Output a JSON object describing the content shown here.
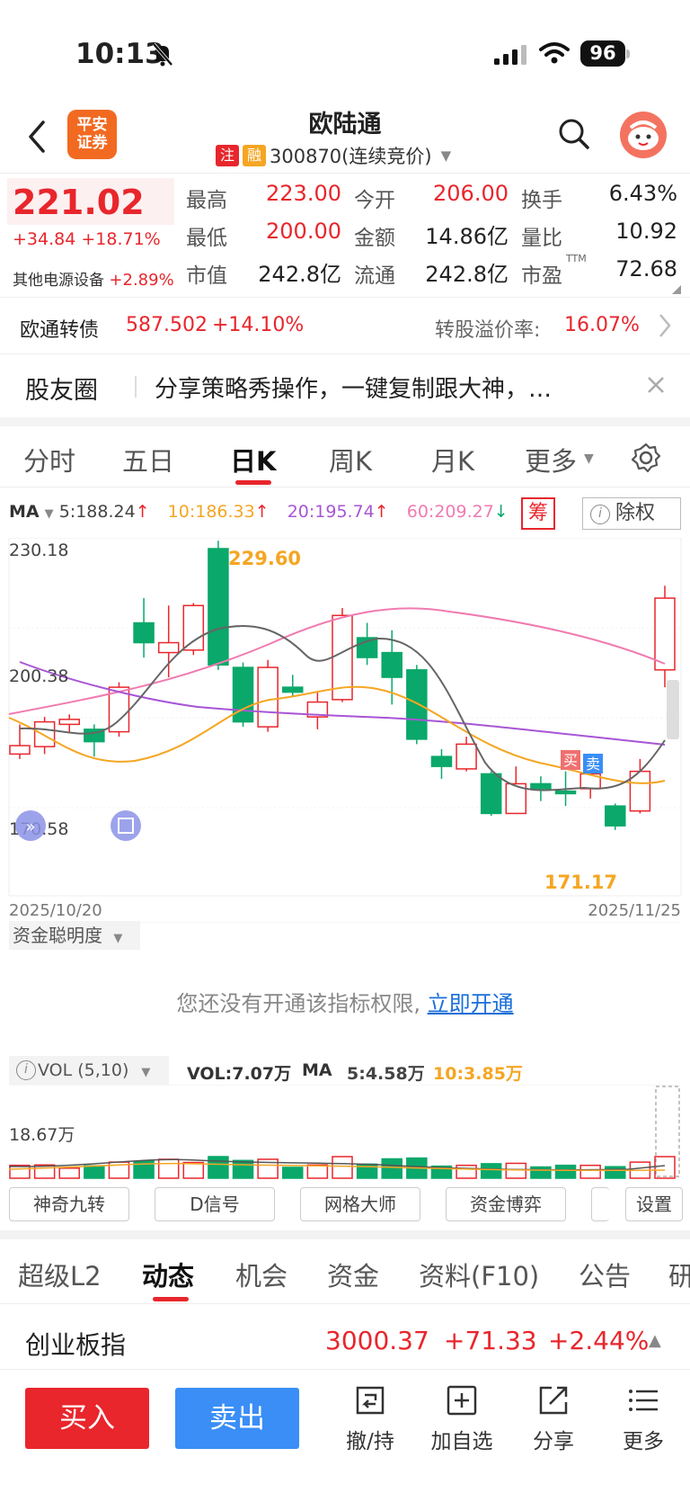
{
  "status_bar": {
    "time": "10:13",
    "battery": "96"
  },
  "header": {
    "logo_text_1": "平安",
    "logo_text_2": "证券",
    "stock_name": "欧陆通",
    "tag_1": "注",
    "tag_2": "融",
    "code_status": "300870(连续竞价)",
    "colors": {
      "red": "#e8262c",
      "green": "#0aa86a",
      "blue": "#3a8ef6",
      "orange": "#f26a21"
    }
  },
  "quote": {
    "price": "221.02",
    "change": "+34.84 +18.71%",
    "sector": "其他电源设备",
    "sector_change": "+2.89%",
    "high_label": "最高",
    "high": "223.00",
    "open_label": "今开",
    "open": "206.00",
    "turnover_label": "换手",
    "turnover": "6.43%",
    "low_label": "最低",
    "low": "200.00",
    "amount_label": "金额",
    "amount": "14.86亿",
    "vol_ratio_label": "量比",
    "vol_ratio": "10.92",
    "mcap_label": "市值",
    "mcap": "242.8亿",
    "float_label": "流通",
    "float_cap": "242.8亿",
    "pe_label": "市盈",
    "pe_sup": "TTM",
    "pe": "72.68"
  },
  "bond": {
    "name": "欧通转债",
    "price": "587.502",
    "change": "+14.10%",
    "premium_label": "转股溢价率:",
    "premium": "16.07%"
  },
  "community": {
    "title": "股友圈",
    "text": "分享策略秀操作，一键复制跟大神，…"
  },
  "k_tabs": [
    {
      "label": "分时"
    },
    {
      "label": "五日"
    },
    {
      "label": "日K"
    },
    {
      "label": "周K"
    },
    {
      "label": "月K"
    },
    {
      "label": "更多"
    }
  ],
  "ma": {
    "label": "MA",
    "ma5": "5:188.24",
    "ma10": "10:186.33",
    "ma20": "20:195.74",
    "ma60": "60:209.27",
    "colors": {
      "ma5": "#555555",
      "ma10": "#f5a623",
      "ma20": "#a855d6",
      "ma60": "#f07bb0"
    },
    "chip_label": "筹",
    "exright_label": "除权"
  },
  "chart": {
    "y_top": "230.18",
    "y_mid": "200.38",
    "y_bottom": "170.58",
    "x_start": "2025/10/20",
    "x_end": "2025/11/25",
    "high_label": "229.60",
    "low_label": "171.17",
    "buy_marker": "买",
    "sell_marker": "卖"
  },
  "chart_data": {
    "type": "candlestick",
    "x_range": [
      "2025/10/20",
      "2025/11/25"
    ],
    "ylim": [
      170.58,
      230.18
    ],
    "candles": [
      {
        "o": 186.5,
        "c": 188.2,
        "h": 192.5,
        "l": 185.5
      },
      {
        "o": 188.0,
        "c": 193.0,
        "h": 194.0,
        "l": 186.5
      },
      {
        "o": 192.5,
        "c": 193.5,
        "h": 194.5,
        "l": 191.0
      },
      {
        "o": 191.5,
        "c": 189.0,
        "h": 192.5,
        "l": 186.0
      },
      {
        "o": 191.0,
        "c": 200.0,
        "h": 201.0,
        "l": 190.0
      },
      {
        "o": 213.0,
        "c": 209.0,
        "h": 218.0,
        "l": 206.0
      },
      {
        "o": 207.0,
        "c": 209.0,
        "h": 216.5,
        "l": 202.0
      },
      {
        "o": 207.5,
        "c": 216.5,
        "h": 217.0,
        "l": 206.5
      },
      {
        "o": 228.0,
        "c": 204.5,
        "h": 229.6,
        "l": 203.5
      },
      {
        "o": 204.0,
        "c": 193.0,
        "h": 205.0,
        "l": 192.0
      },
      {
        "o": 192.0,
        "c": 204.0,
        "h": 205.5,
        "l": 191.0
      },
      {
        "o": 200.0,
        "c": 199.0,
        "h": 202.5,
        "l": 198.0
      },
      {
        "o": 194.0,
        "c": 197.0,
        "h": 199.0,
        "l": 191.5
      },
      {
        "o": 197.5,
        "c": 214.5,
        "h": 216.0,
        "l": 197.0
      },
      {
        "o": 210.0,
        "c": 206.0,
        "h": 213.0,
        "l": 204.5
      },
      {
        "o": 207.0,
        "c": 202.0,
        "h": 211.5,
        "l": 196.5
      },
      {
        "o": 203.5,
        "c": 189.5,
        "h": 204.5,
        "l": 188.5
      },
      {
        "o": 186.0,
        "c": 184.0,
        "h": 187.5,
        "l": 181.5
      },
      {
        "o": 183.5,
        "c": 188.5,
        "h": 190.0,
        "l": 183.0
      },
      {
        "o": 182.5,
        "c": 174.5,
        "h": 183.0,
        "l": 174.0
      },
      {
        "o": 174.5,
        "c": 180.5,
        "h": 184.0,
        "l": 174.5
      },
      {
        "o": 180.5,
        "c": 179.5,
        "h": 182.0,
        "l": 177.0
      },
      {
        "o": 179.0,
        "c": 178.5,
        "h": 183.0,
        "l": 176.0
      },
      {
        "o": 179.5,
        "c": 182.5,
        "h": 184.5,
        "l": 177.5
      },
      {
        "o": 176.0,
        "c": 172.0,
        "h": 176.5,
        "l": 171.17
      },
      {
        "o": 175.0,
        "c": 183.0,
        "h": 185.5,
        "l": 174.5
      },
      {
        "o": 203.5,
        "c": 218.0,
        "h": 220.5,
        "l": 200.0
      }
    ]
  },
  "indicator": {
    "label": "资金聪明度",
    "message": "您还没有开通该指标权限,",
    "link": "立即开通"
  },
  "volume": {
    "selector": "VOL (5,10)",
    "vol": "VOL:7.07万",
    "ma_label": "MA",
    "ma5": "5:4.58万",
    "ma10": "10:3.85万",
    "y_max": "18.67万"
  },
  "tools": {
    "t1": "神奇九转",
    "t2": "D信号",
    "t3": "网格大师",
    "t4": "资金博弈",
    "settings": "设置"
  },
  "bottom_tabs": [
    {
      "label": "超级L2"
    },
    {
      "label": "动态"
    },
    {
      "label": "机会"
    },
    {
      "label": "资金"
    },
    {
      "label": "资料(F10)"
    },
    {
      "label": "公告"
    },
    {
      "label": "研"
    }
  ],
  "index": {
    "name": "创业板指",
    "value": "3000.37",
    "change": "+71.33",
    "pct": "+2.44%"
  },
  "actions": {
    "buy": "买入",
    "sell": "卖出",
    "hold": "撤/持",
    "add": "加自选",
    "share": "分享",
    "more": "更多"
  }
}
